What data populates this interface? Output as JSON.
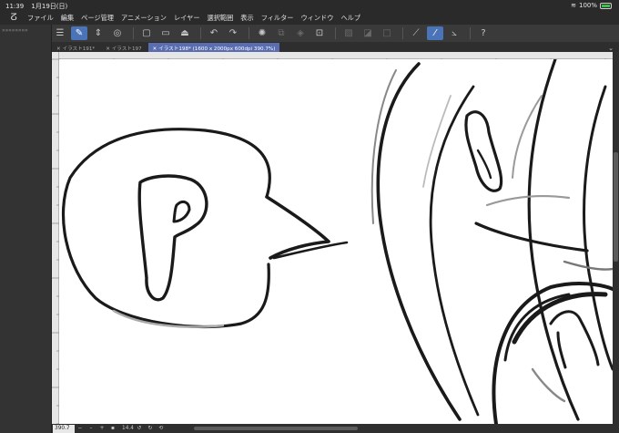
{
  "status_bar": {
    "time": "11:39",
    "date": "1月19日(日)",
    "battery": "100%"
  },
  "menu": {
    "items": [
      "ファイル",
      "編集",
      "ページ管理",
      "アニメーション",
      "レイヤー",
      "選択範囲",
      "表示",
      "フィルター",
      "ウィンドウ",
      "ヘルプ"
    ]
  },
  "tabs": [
    {
      "label": "イラスト191*"
    },
    {
      "label": "イラスト197"
    },
    {
      "label": "イラスト198* (1600 x 2000px 600dpi 390.7%)"
    }
  ],
  "bottom": {
    "zoom": "390.7",
    "angle": "14.4"
  },
  "colors": {
    "accent": "#4b74b8",
    "tab_active": "#5a6db0"
  }
}
